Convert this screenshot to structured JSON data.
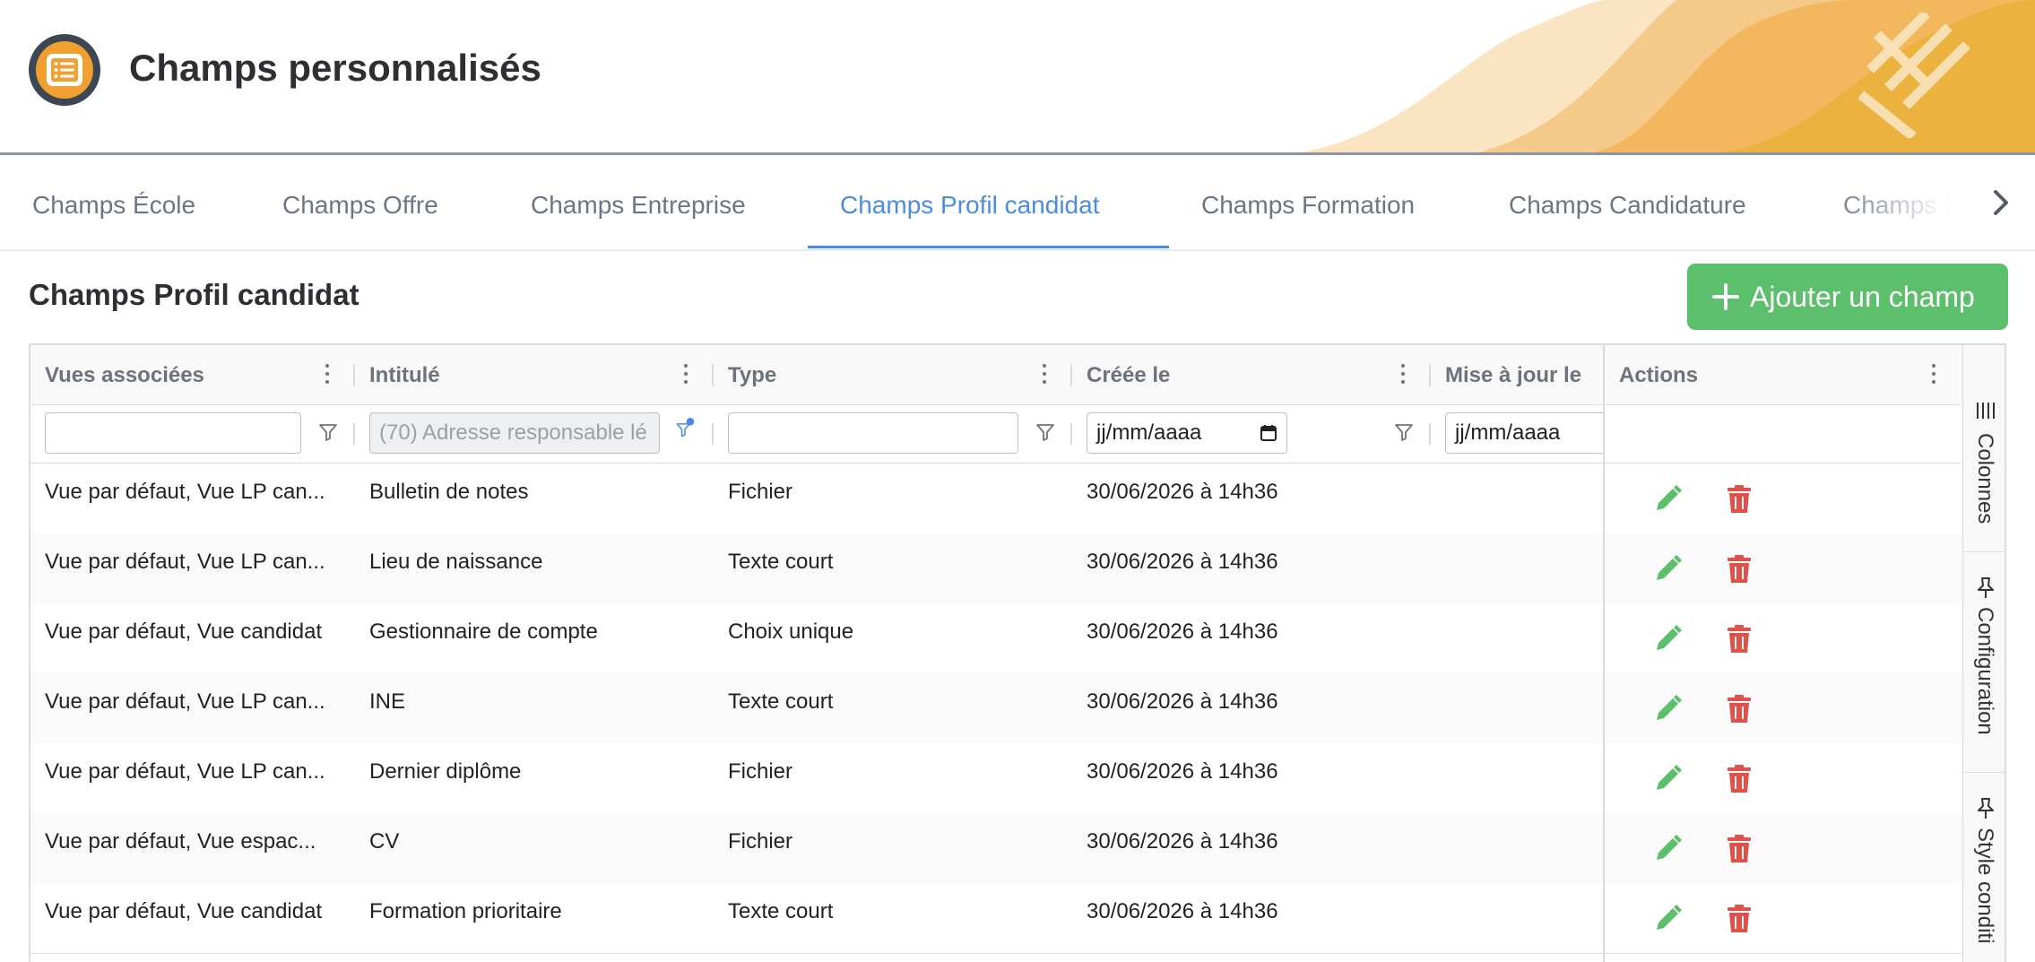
{
  "header": {
    "title": "Champs personnalisés",
    "accent_color": "#f0a030"
  },
  "tabs": [
    {
      "label": "Champs École",
      "active": false
    },
    {
      "label": "Champs Offre",
      "active": false
    },
    {
      "label": "Champs Entreprise",
      "active": false
    },
    {
      "label": "Champs Profil candidat",
      "active": true
    },
    {
      "label": "Champs Formation",
      "active": false
    },
    {
      "label": "Champs Candidature",
      "active": false
    },
    {
      "label": "Champs U",
      "active": false
    }
  ],
  "section": {
    "title": "Champs Profil candidat",
    "add_button_label": "Ajouter un champ",
    "add_button_color": "#5cbf6b"
  },
  "grid": {
    "columns": [
      {
        "label": "Vues associées"
      },
      {
        "label": "Intitulé"
      },
      {
        "label": "Type"
      },
      {
        "label": "Créée le"
      },
      {
        "label": "Mise à jour le"
      },
      {
        "label": "Actions"
      }
    ],
    "filters": {
      "vues": "",
      "intitule": "(70) Adresse responsable lé",
      "type": "",
      "creee_le": "jj/mm/aaaa",
      "mise_a_jour": "jj/mm/aaaa"
    },
    "rows": [
      {
        "vues": "Vue par défaut, Vue LP can...",
        "intitule": "Bulletin de notes",
        "type": "Fichier",
        "creee": "30/06/2026 à 14h36",
        "maj": ""
      },
      {
        "vues": "Vue par défaut, Vue LP can...",
        "intitule": "Lieu de naissance",
        "type": "Texte court",
        "creee": "30/06/2026 à 14h36",
        "maj": ""
      },
      {
        "vues": "Vue par défaut, Vue candidat",
        "intitule": "Gestionnaire de compte",
        "type": "Choix unique",
        "creee": "30/06/2026 à 14h36",
        "maj": ""
      },
      {
        "vues": "Vue par défaut, Vue LP can...",
        "intitule": "INE",
        "type": "Texte court",
        "creee": "30/06/2026 à 14h36",
        "maj": ""
      },
      {
        "vues": "Vue par défaut, Vue LP can...",
        "intitule": "Dernier diplôme",
        "type": "Fichier",
        "creee": "30/06/2026 à 14h36",
        "maj": ""
      },
      {
        "vues": "Vue par défaut, Vue espac...",
        "intitule": "CV",
        "type": "Fichier",
        "creee": "30/06/2026 à 14h36",
        "maj": ""
      },
      {
        "vues": "Vue par défaut, Vue candidat",
        "intitule": "Formation prioritaire",
        "type": "Texte court",
        "creee": "30/06/2026 à 14h36",
        "maj": ""
      }
    ],
    "row_actions": {
      "edit_icon": "pencil-icon",
      "delete_icon": "trash-icon",
      "edit_color": "#5cbf6b",
      "delete_color": "#e0514a"
    }
  },
  "side_panel": {
    "tabs": [
      {
        "label": "Colonnes",
        "icon": "columns-icon"
      },
      {
        "label": "Configuration",
        "icon": "pin-icon"
      },
      {
        "label": "Style conditi",
        "icon": "pin-icon"
      }
    ]
  }
}
